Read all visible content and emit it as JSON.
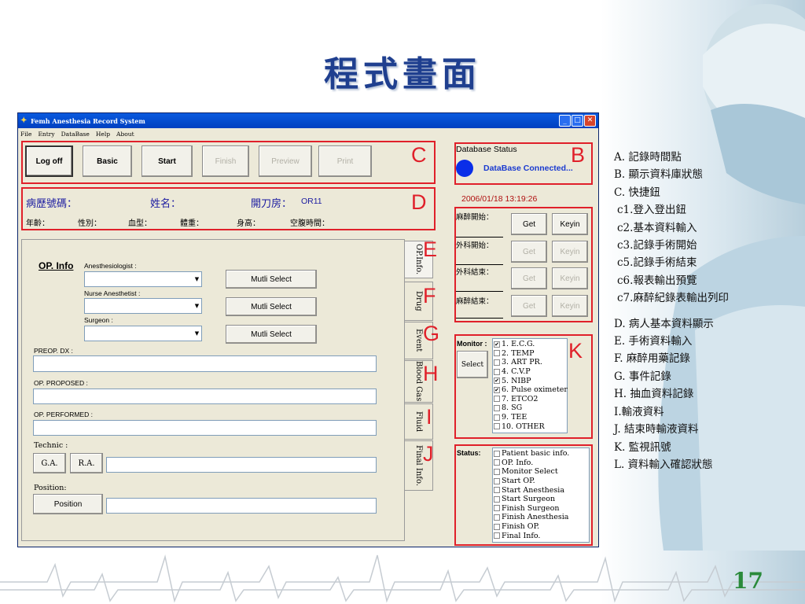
{
  "slide": {
    "title": "程式畫面",
    "page_number": "17"
  },
  "legend": {
    "items": [
      "A. 記錄時間點",
      "B. 顯示資料庫狀態",
      "C. 快捷鈕",
      "c1.登入登出鈕",
      "c2.基本資料輸入",
      "c3.記錄手術開始",
      "c5.記錄手術結束",
      "c6.報表輸出預覽",
      "c7.麻醉紀錄表輸出列印",
      "D. 病人基本資料顯示",
      "E. 手術資料輸入",
      "F. 麻醉用藥記錄",
      "G. 事件記錄",
      "H. 抽血資料記錄",
      "I.輸液資料",
      "J. 結束時輸液資料",
      "K. 監視訊號",
      "L. 資料輸入確認狀態"
    ]
  },
  "window": {
    "title": "Femh Anesthesia Record System",
    "menu": [
      "File",
      "Entry",
      "DataBase",
      "Help",
      "About"
    ],
    "controls": [
      "_",
      "□",
      "✕"
    ]
  },
  "markers": [
    "A",
    "B",
    "C",
    "D",
    "E",
    "F",
    "G",
    "H",
    "I",
    "J",
    "K",
    "L"
  ],
  "toolbar": {
    "buttons": [
      "Log off",
      "Basic",
      "Start",
      "Finish",
      "Preview",
      "Print"
    ]
  },
  "patient": {
    "chart_no_label": "病歷號碼：",
    "name_label": "姓名：",
    "room_label": "開刀房：",
    "room_value": "OR11",
    "age_label": "年齡：",
    "sex_label": "性別：",
    "blood_label": "血型：",
    "weight_label": "體重：",
    "height_label": "身高：",
    "fasting_label": "空腹時間："
  },
  "db_status": {
    "label": "Database Status",
    "value": "DataBase Connected...",
    "indicator_color": "#0a2ee8"
  },
  "timestamp": "2006/01/18 13:19:26",
  "time_points": [
    {
      "label": "麻醉開始：",
      "get": "Get",
      "keyin": "Keyin"
    },
    {
      "label": "外科開始：",
      "get": "Get",
      "keyin": "Keyin"
    },
    {
      "label": "外科結束：",
      "get": "Get",
      "keyin": "Keyin"
    },
    {
      "label": "麻醉結束：",
      "get": "Get",
      "keyin": "Keyin"
    }
  ],
  "op_info": {
    "heading": "OP. Info",
    "anesthesiologist_label": "Anesthesiologist :",
    "nurse_label": "Nurse Anesthetist :",
    "surgeon_label": "Surgeon :",
    "multi_select": "Mutli Select",
    "preop_dx_label": "PREOP. DX :",
    "op_proposed_label": "OP. PROPOSED :",
    "op_performed_label": "OP. PERFORMED :",
    "technic_label": "Technic :",
    "ga": "G.A.",
    "ra": "R.A.",
    "position_label": "Position:",
    "position_button": "Position"
  },
  "tabs": [
    "OP.Info.",
    "Drug",
    "Event",
    "Blood Gas",
    "Fluid",
    "Final Info."
  ],
  "monitor": {
    "label": "Monitor :",
    "select_button": "Select",
    "items": [
      {
        "text": "1. E.C.G.",
        "checked": true
      },
      {
        "text": "2. TEMP",
        "checked": false
      },
      {
        "text": "3. ART PR.",
        "checked": false
      },
      {
        "text": "4. C.V.P",
        "checked": false
      },
      {
        "text": "5. NIBP",
        "checked": true
      },
      {
        "text": "6. Pulse oximeter",
        "checked": true
      },
      {
        "text": "7. ETCO2",
        "checked": false
      },
      {
        "text": "8. SG",
        "checked": false
      },
      {
        "text": "9. TEE",
        "checked": false
      },
      {
        "text": "10. OTHER",
        "checked": false
      }
    ]
  },
  "status": {
    "label": "Status:",
    "items": [
      {
        "text": "Patient basic info.",
        "checked": false
      },
      {
        "text": "OP. Info.",
        "checked": false
      },
      {
        "text": "Monitor Select",
        "checked": false
      },
      {
        "text": "Start OP.",
        "checked": false
      },
      {
        "text": "Start Anesthesia",
        "checked": false
      },
      {
        "text": "Start Surgeon",
        "checked": false
      },
      {
        "text": "Finish Surgeon",
        "checked": false
      },
      {
        "text": "Finish Anesthesia",
        "checked": false
      },
      {
        "text": "Finish OP.",
        "checked": false
      },
      {
        "text": "Final Info.",
        "checked": false
      }
    ]
  }
}
